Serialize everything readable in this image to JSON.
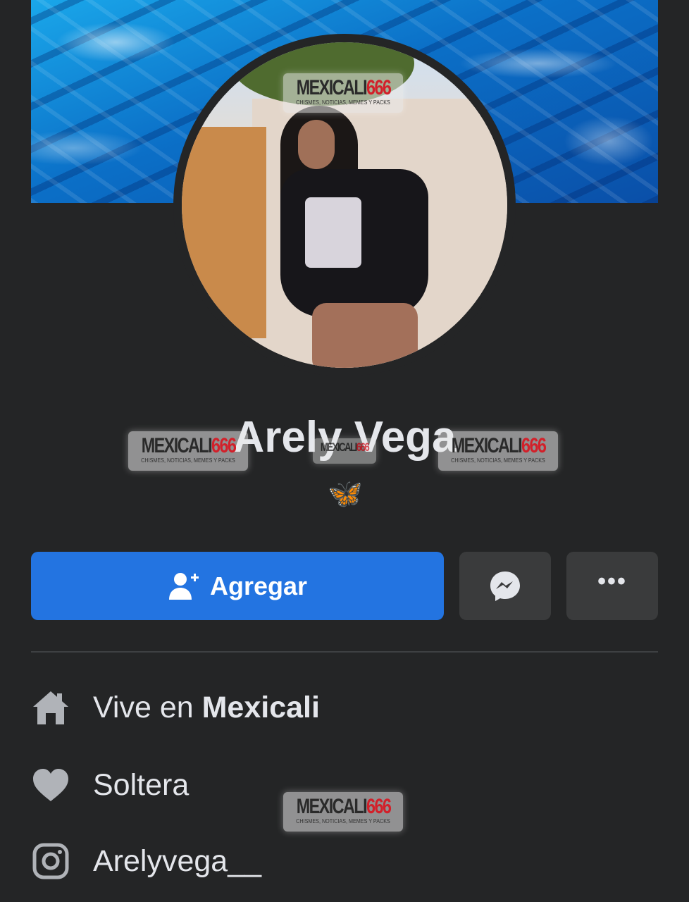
{
  "profile": {
    "name": "Arely Vega",
    "bio_icon": "butterfly-emoji",
    "bio_glyph": "🦋"
  },
  "actions": {
    "add_label": "Agregar",
    "add_icon": "add-friend-icon",
    "message_icon": "messenger-icon",
    "more_icon": "more-options-icon",
    "more_glyph": "•••",
    "accent_color": "#2374e1"
  },
  "details": {
    "location_prefix": "Vive en ",
    "location_value": "Mexicali",
    "location_icon": "home-icon",
    "relationship": "Soltera",
    "relationship_icon": "heart-icon",
    "instagram": "Arelyvega__",
    "instagram_icon": "instagram-icon"
  },
  "watermark": {
    "brand": "MEXICALI",
    "number": "666",
    "tagline": "CHISMES, NOTICIAS, MEMES Y PACKS"
  }
}
